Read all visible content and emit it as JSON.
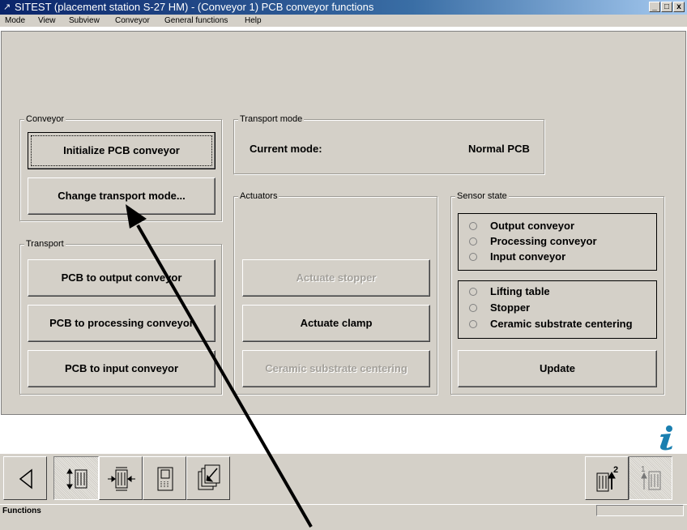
{
  "window": {
    "title": "SITEST (placement station S-27 HM) - (Conveyor 1) PCB conveyor functions",
    "controls": [
      "_",
      "□",
      "x"
    ]
  },
  "menu": [
    "Mode",
    "View",
    "Subview",
    "Conveyor",
    "General functions",
    "Help"
  ],
  "conveyor": {
    "label": "Conveyor",
    "init_button": "Initialize PCB conveyor",
    "change_mode_button": "Change transport mode..."
  },
  "transport_mode": {
    "label": "Transport mode",
    "current_label": "Current mode:",
    "current_value": "Normal PCB"
  },
  "transport": {
    "label": "Transport",
    "to_output": "PCB to output conveyor",
    "to_processing": "PCB to processing conveyor",
    "to_input": "PCB to input conveyor"
  },
  "actuators": {
    "label": "Actuators",
    "stopper": "Actuate stopper",
    "clamp": "Actuate clamp",
    "centering": "Ceramic substrate centering"
  },
  "sensor_state": {
    "label": "Sensor state",
    "group1": [
      "Output conveyor",
      "Processing conveyor",
      "Input conveyor"
    ],
    "group2": [
      "Lifting table",
      "Stopper",
      "Ceramic substrate centering"
    ],
    "update_button": "Update"
  },
  "toolbar": {
    "right_badge_1": "2",
    "right_badge_2": "1"
  },
  "status": {
    "text": "Functions"
  },
  "colors": {
    "panel": "#d4d0c8",
    "titlebar": "#0a246a",
    "disabled_text": "#a3a09a",
    "info_icon": "#1a7fb0"
  },
  "icons": [
    "back-triangle-icon",
    "conveyor-transport-icon",
    "conveyor-center-icon",
    "pcb-grid-icon",
    "pcb-stack-icon",
    "conveyor-2-icon",
    "conveyor-1-icon",
    "info-icon",
    "app-icon"
  ]
}
